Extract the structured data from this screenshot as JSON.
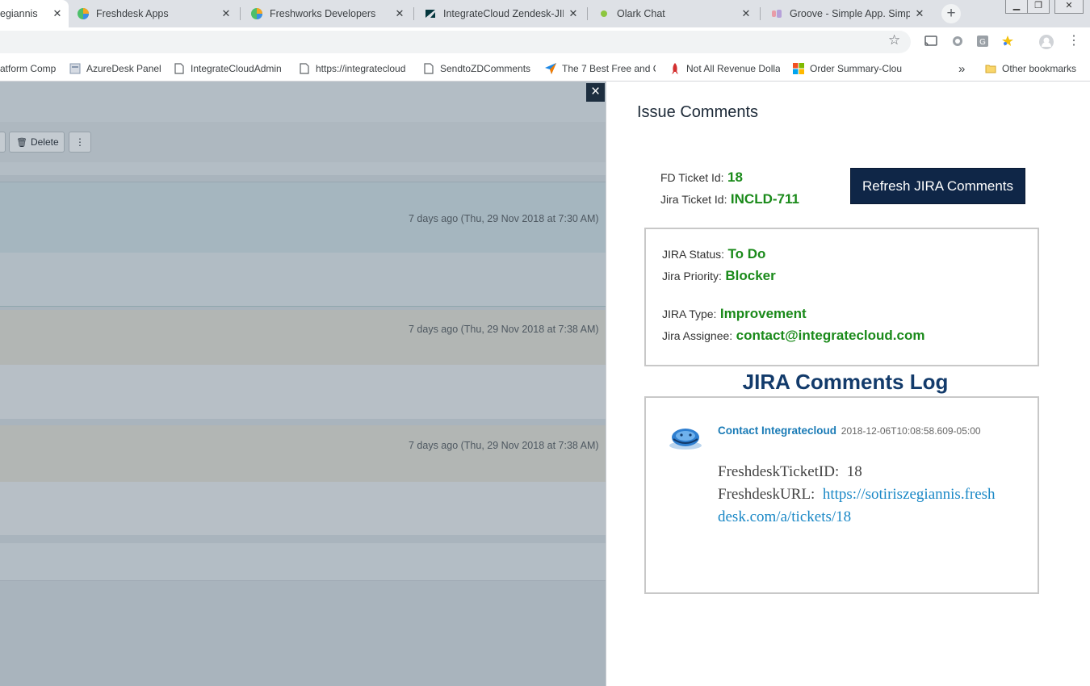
{
  "tabs": [
    {
      "title": "egiannis",
      "active": true
    },
    {
      "title": "Freshdesk Apps"
    },
    {
      "title": "Freshworks Developers"
    },
    {
      "title": "IntegrateCloud Zendesk-JIRA"
    },
    {
      "title": "Olark Chat"
    },
    {
      "title": "Groove - Simple App. Simple"
    }
  ],
  "bookmarks": [
    {
      "title": "atform Comp"
    },
    {
      "title": "AzureDesk Panel"
    },
    {
      "title": "IntegrateCloudAdmin"
    },
    {
      "title": "https://integratecloud"
    },
    {
      "title": "SendtoZDComments"
    },
    {
      "title": "The 7 Best Free and C"
    },
    {
      "title": "Not All Revenue Dolla"
    },
    {
      "title": "Order Summary-Clou"
    },
    {
      "title": "Other bookmarks"
    }
  ],
  "bookmarks_overflow": "»",
  "background": {
    "delete_label": "Delete",
    "timestamps": [
      "7 days ago (Thu, 29 Nov 2018 at 7:30 AM)",
      "7 days ago (Thu, 29 Nov 2018 at 7:38 AM)",
      "7 days ago (Thu, 29 Nov 2018 at 7:38 AM)"
    ]
  },
  "panel": {
    "title": "Issue Comments",
    "close_icon": "×",
    "fd_ticket_label": "FD Ticket Id:",
    "fd_ticket_value": "18",
    "jira_ticket_label": "Jira Ticket Id:",
    "jira_ticket_value": "INCLD-711",
    "refresh_button": "Refresh JIRA Comments",
    "status_label": "JIRA Status:",
    "status_value": "To Do",
    "priority_label": "Jira Priority:",
    "priority_value": "Blocker",
    "type_label": "JIRA Type:",
    "type_value": "Improvement",
    "assignee_label": "Jira Assignee:",
    "assignee_value": "contact@integratecloud.com",
    "log_title": "JIRA Comments Log",
    "comment": {
      "author": "Contact Integratecloud",
      "timestamp": "2018-12-06T10:08:58.609-05:00",
      "ticket_line_label": "FreshdeskTicketID:",
      "ticket_line_value": "18",
      "url_label": "FreshdeskURL:",
      "url_line1": "https://sotiriszegiannis.fresh",
      "url_line2": "desk.com/a/tickets/18"
    }
  },
  "colors": {
    "accent_navy": "#0f2647",
    "value_green": "#1a8a1a",
    "link_blue": "#1a88c6",
    "log_title": "#133b6b"
  }
}
